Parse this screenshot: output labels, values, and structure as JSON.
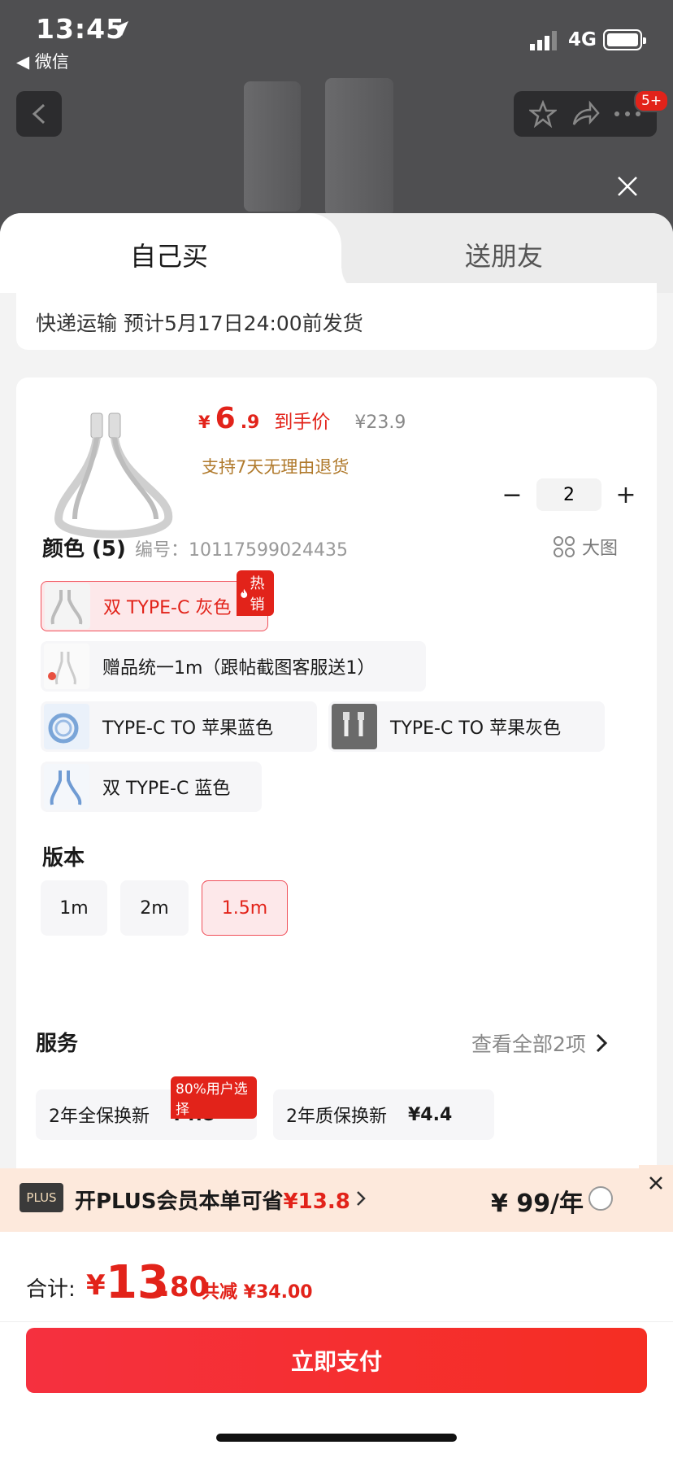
{
  "status_bar": {
    "time": "13:45",
    "back_app": "◀ 微信",
    "network": "4G"
  },
  "nav": {
    "more_badge": "5+"
  },
  "tabs": [
    {
      "label": "自己买"
    },
    {
      "label": "送朋友"
    }
  ],
  "shipping": {
    "text": "快递运输 预计5月17日24:00前发货"
  },
  "product": {
    "price_yen": "¥",
    "price_int": "6",
    "price_dec": ".9",
    "price_label": "到手价",
    "original_price": "¥23.9",
    "return_note": "支持7天无理由退货",
    "quantity": "2"
  },
  "color_section": {
    "title": "颜色 (5)",
    "sku": "编号：10117599024435",
    "big_image_label": "大图",
    "hot_badge": "热销",
    "options": [
      {
        "label": "双 TYPE-C 灰色"
      },
      {
        "label": "赠品统一1m（跟帖截图客服送1）"
      },
      {
        "label": "TYPE-C TO 苹果蓝色"
      },
      {
        "label": "TYPE-C TO 苹果灰色"
      },
      {
        "label": "双 TYPE-C 蓝色"
      }
    ]
  },
  "version_section": {
    "title": "版本",
    "options": [
      {
        "label": "1m"
      },
      {
        "label": "2m"
      },
      {
        "label": "1.5m"
      }
    ]
  },
  "service_section": {
    "title": "服务",
    "view_all": "查看全部2项",
    "badge": "80%用户选择",
    "items": [
      {
        "label": "2年全保换新",
        "price": "¥4.8"
      },
      {
        "label": "2年质保换新",
        "price": "¥4.4"
      }
    ]
  },
  "plus_bar": {
    "logo": "PLUS",
    "text_prefix": "开PLUS会员本单可省",
    "save": "¥13.8",
    "price": "¥ 99/年"
  },
  "footer": {
    "total_label": "合计:",
    "total_yen": "¥",
    "total_int": "13",
    "total_dec": ".80",
    "total_save": "共减 ¥34.00",
    "pay_label": "立即支付"
  },
  "colors": {
    "accent": "#e2231a",
    "pay_button": "#f5303f",
    "selected_bg": "#fde8ea"
  }
}
